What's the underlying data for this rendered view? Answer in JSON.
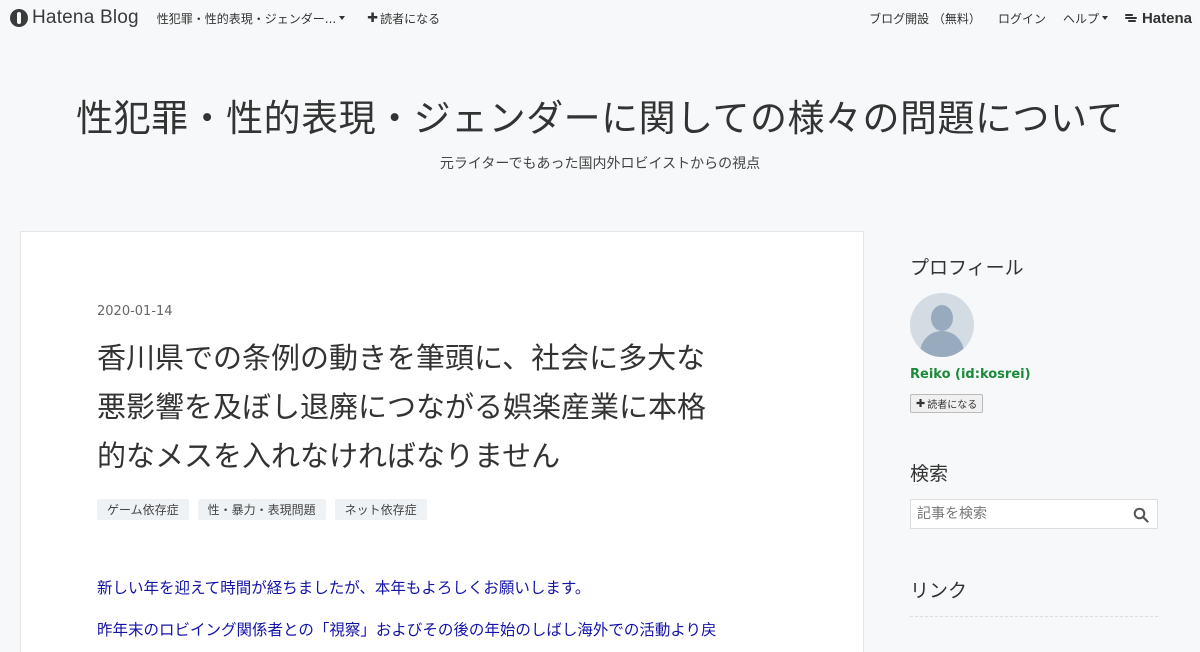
{
  "globalheader": {
    "logo_text": "Hatena Blog",
    "blog_name": "性犯罪・性的表現・ジェンダー...",
    "subscribe_label": "読者になる",
    "links": [
      "ブログ開設 （無料）",
      "ログイン",
      "ヘルプ"
    ],
    "hatena_label": "Hatena"
  },
  "blog": {
    "title": "性犯罪・性的表現・ジェンダーに関しての様々の問題について",
    "description": "元ライターでもあった国内外ロビイストからの視点"
  },
  "entry": {
    "date": "2020-01-14",
    "title_lines": [
      "香川県での条例の動きを筆頭に、社会に多大な",
      "悪影響を及ぼし退廃につながる娯楽産業に本格",
      "的なメスを入れなければなりません"
    ],
    "categories": [
      "ゲーム依存症",
      "性・暴力・表現問題",
      "ネット依存症"
    ],
    "paragraphs": [
      "新しい年を迎えて時間が経ちましたが、本年もよろしくお願いします。",
      "昨年末のロビイング関係者との「視察」およびその後の年始のしばし海外での活動より戻"
    ]
  },
  "sidebar": {
    "profile_title": "プロフィール",
    "profile_name": "Reiko  (id:kosrei)",
    "subscribe_label": "読者になる",
    "search_title": "検索",
    "search_placeholder": "記事を検索",
    "link_title": "リンク"
  },
  "colors": {
    "background": "#f6f8f9",
    "paragraph_text": "#1313a8",
    "profile_name": "#1c8a3a",
    "category_bg": "#eef2f4"
  }
}
